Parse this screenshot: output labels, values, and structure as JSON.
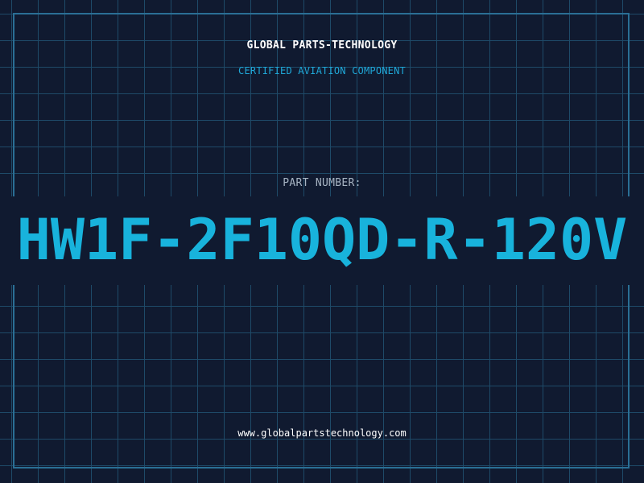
{
  "brand": {
    "name": "GLOBAL PARTS-TECHNOLOGY",
    "tagline": "CERTIFIED AVIATION COMPONENT"
  },
  "part": {
    "label": "PART NUMBER:",
    "number": "HW1F-2F10QD-R-120V"
  },
  "footer": {
    "website": "www.globalpartstechnology.com"
  },
  "colors": {
    "background": "#101a30",
    "grid": "#1e4a68",
    "accent": "#18b3dc",
    "text": "#ffffff",
    "muted": "#a7b4c3"
  }
}
